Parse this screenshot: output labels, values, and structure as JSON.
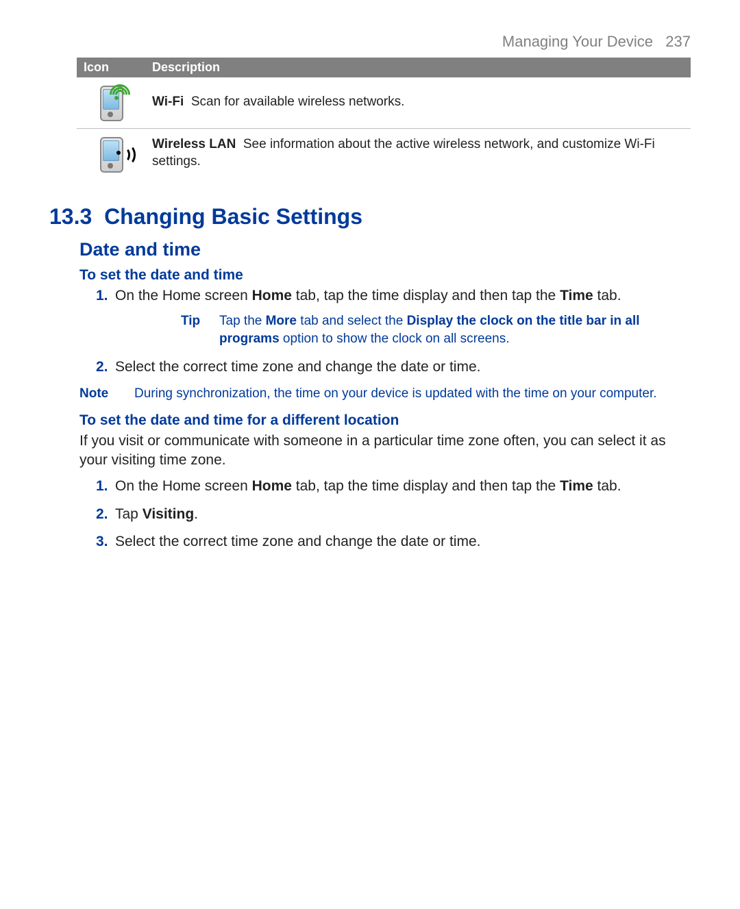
{
  "header": {
    "chapter": "Managing Your Device",
    "page_number": "237"
  },
  "table": {
    "columns": {
      "icon": "Icon",
      "description": "Description"
    },
    "rows": [
      {
        "icon_name": "pda-wifi-icon",
        "term": "Wi-Fi",
        "desc": "Scan for available wireless networks."
      },
      {
        "icon_name": "pda-wireless-lan-icon",
        "term": "Wireless LAN",
        "desc": "See information about the active wireless network, and customize Wi-Fi settings."
      }
    ]
  },
  "section": {
    "number": "13.3",
    "title": "Changing Basic Settings",
    "subsection": "Date and time",
    "heading1": "To set the date and time",
    "steps1": {
      "num1": "1.",
      "s1a": "On the Home screen ",
      "s1b": "Home",
      "s1c": " tab, tap the time display and then tap the ",
      "s1d": "Time",
      "s1e": " tab.",
      "num2": "2.",
      "s2": "Select the correct time zone and change the date or time."
    },
    "tip": {
      "label": "Tip",
      "t1": "Tap the ",
      "t2": "More",
      "t3": " tab and select the ",
      "t4": "Display the clock on the title bar in all programs",
      "t5": " option to show the clock on all screens."
    },
    "note": {
      "label": "Note",
      "text": "During synchronization, the time on your device is updated with the time on your computer."
    },
    "heading2": "To set the date and time for a different location",
    "intro2": "If you visit or communicate with someone in a particular time zone often, you can select it as your visiting time zone.",
    "steps2": {
      "num1": "1.",
      "s1a": "On the Home screen ",
      "s1b": "Home",
      "s1c": " tab, tap the time display and then tap the ",
      "s1d": "Time",
      "s1e": " tab.",
      "num2": "2.",
      "s2a": "Tap ",
      "s2b": "Visiting",
      "s2c": ".",
      "num3": "3.",
      "s3": "Select the correct time zone and change the date or time."
    }
  }
}
